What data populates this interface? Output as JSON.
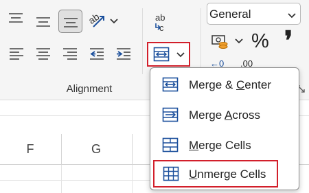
{
  "ribbon": {
    "group_label": "Alignment",
    "alignment_icons": [
      "align-top-icon",
      "align-middle-icon",
      "align-bottom-icon",
      "orientation-icon",
      "chevron-down-icon",
      "align-left-icon",
      "align-center-icon",
      "align-right-icon",
      "decrease-indent-icon",
      "increase-indent-icon",
      "wrap-text-icon",
      "merge-center-icon",
      "chevron-down-icon"
    ],
    "number_format": "General",
    "percent_symbol": "%",
    "comma_symbol": "❜",
    "decimal_increase": "←0",
    "decimal_decrease": ".00",
    "accent": "#1b4f9c",
    "highlight": "#d21f2b"
  },
  "sheet": {
    "columns": [
      "F",
      "G"
    ]
  },
  "merge_menu": {
    "items": [
      {
        "pre": "Merge & ",
        "key": "C",
        "post": "enter",
        "icon": "merge-center-icon"
      },
      {
        "pre": "Merge ",
        "key": "A",
        "post": "cross",
        "icon": "merge-across-icon"
      },
      {
        "pre": "",
        "key": "M",
        "post": "erge Cells",
        "icon": "merge-cells-icon"
      },
      {
        "pre": "",
        "key": "U",
        "post": "nmerge Cells",
        "icon": "unmerge-cells-icon"
      }
    ]
  }
}
